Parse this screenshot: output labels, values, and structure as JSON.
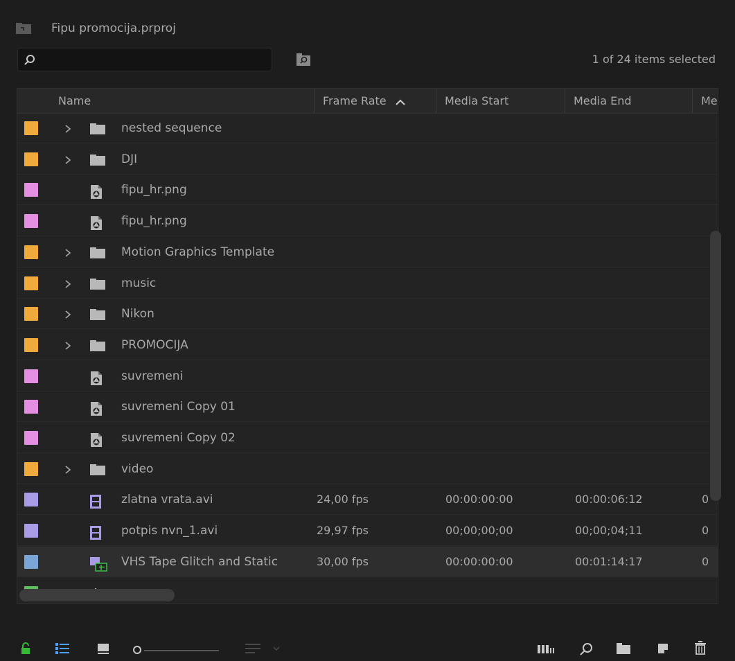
{
  "project": {
    "title": "Fipu promocija.prproj"
  },
  "search": {
    "placeholder": "",
    "value": ""
  },
  "selection": {
    "count_text": "1 of 24 items selected"
  },
  "columns": {
    "name": "Name",
    "frame_rate": "Frame Rate",
    "media_start": "Media Start",
    "media_end": "Media End",
    "more": "Me"
  },
  "rows": [
    {
      "name": "nested sequence",
      "type": "bin",
      "label_color": "#f0a93b",
      "expandable": true,
      "frame_rate": "",
      "media_start": "",
      "media_end": "",
      "more": ""
    },
    {
      "name": "DJI",
      "type": "bin",
      "label_color": "#f0a93b",
      "expandable": true,
      "frame_rate": "",
      "media_start": "",
      "media_end": "",
      "more": ""
    },
    {
      "name": "fipu_hr.png",
      "type": "image",
      "label_color": "#e38ee0",
      "expandable": false,
      "frame_rate": "",
      "media_start": "",
      "media_end": "",
      "more": ""
    },
    {
      "name": "fipu_hr.png",
      "type": "image",
      "label_color": "#e38ee0",
      "expandable": false,
      "frame_rate": "",
      "media_start": "",
      "media_end": "",
      "more": ""
    },
    {
      "name": "Motion Graphics Template",
      "type": "bin",
      "label_color": "#f0a93b",
      "expandable": true,
      "frame_rate": "",
      "media_start": "",
      "media_end": "",
      "more": ""
    },
    {
      "name": "music",
      "type": "bin",
      "label_color": "#f0a93b",
      "expandable": true,
      "frame_rate": "",
      "media_start": "",
      "media_end": "",
      "more": ""
    },
    {
      "name": "Nikon",
      "type": "bin",
      "label_color": "#f0a93b",
      "expandable": true,
      "frame_rate": "",
      "media_start": "",
      "media_end": "",
      "more": ""
    },
    {
      "name": "PROMOCIJA",
      "type": "bin",
      "label_color": "#f0a93b",
      "expandable": true,
      "frame_rate": "",
      "media_start": "",
      "media_end": "",
      "more": ""
    },
    {
      "name": "suvremeni",
      "type": "image",
      "label_color": "#e38ee0",
      "expandable": false,
      "frame_rate": "",
      "media_start": "",
      "media_end": "",
      "more": ""
    },
    {
      "name": "suvremeni Copy 01",
      "type": "image",
      "label_color": "#e38ee0",
      "expandable": false,
      "frame_rate": "",
      "media_start": "",
      "media_end": "",
      "more": ""
    },
    {
      "name": "suvremeni Copy 02",
      "type": "image",
      "label_color": "#e38ee0",
      "expandable": false,
      "frame_rate": "",
      "media_start": "",
      "media_end": "",
      "more": ""
    },
    {
      "name": "video",
      "type": "bin",
      "label_color": "#f0a93b",
      "expandable": true,
      "frame_rate": "",
      "media_start": "",
      "media_end": "",
      "more": ""
    },
    {
      "name": "zlatna vrata.avi",
      "type": "video",
      "label_color": "#a99be6",
      "expandable": false,
      "frame_rate": "24,00 fps",
      "media_start": "00:00:00:00",
      "media_end": "00:00:06:12",
      "more": "0"
    },
    {
      "name": "potpis nvn_1.avi",
      "type": "video",
      "label_color": "#a99be6",
      "expandable": false,
      "frame_rate": "29,97 fps",
      "media_start": "00;00;00;00",
      "media_end": "00;00;04;11",
      "more": "0"
    },
    {
      "name": "VHS Tape Glitch and Static",
      "type": "sequence",
      "label_color": "#7aa5d9",
      "expandable": false,
      "frame_rate": "30,00 fps",
      "media_start": "00:00:00:00",
      "media_end": "00:01:14:17",
      "more": "0",
      "selected": true
    },
    {
      "name": "",
      "type": "audio",
      "label_color": "#5fbf5a",
      "expandable": false,
      "frame_rate": "",
      "media_start": "",
      "media_end": "",
      "more": ""
    }
  ],
  "icons": {
    "project": "project-bin-icon",
    "search": "search-icon",
    "bin_search": "find-in-bin-icon",
    "lock": "lock-icon",
    "list_view": "list-view-icon",
    "icon_view": "icon-view-icon",
    "zoom_slider": "zoom-slider",
    "sort": "sort-icon",
    "automate": "automate-to-sequence-icon",
    "find": "find-icon",
    "new_bin": "new-bin-icon",
    "new_item": "new-item-icon",
    "clear": "trash-icon"
  },
  "colors": {
    "lock_green": "#35b936",
    "list_view_blue": "#4fa1ff"
  }
}
